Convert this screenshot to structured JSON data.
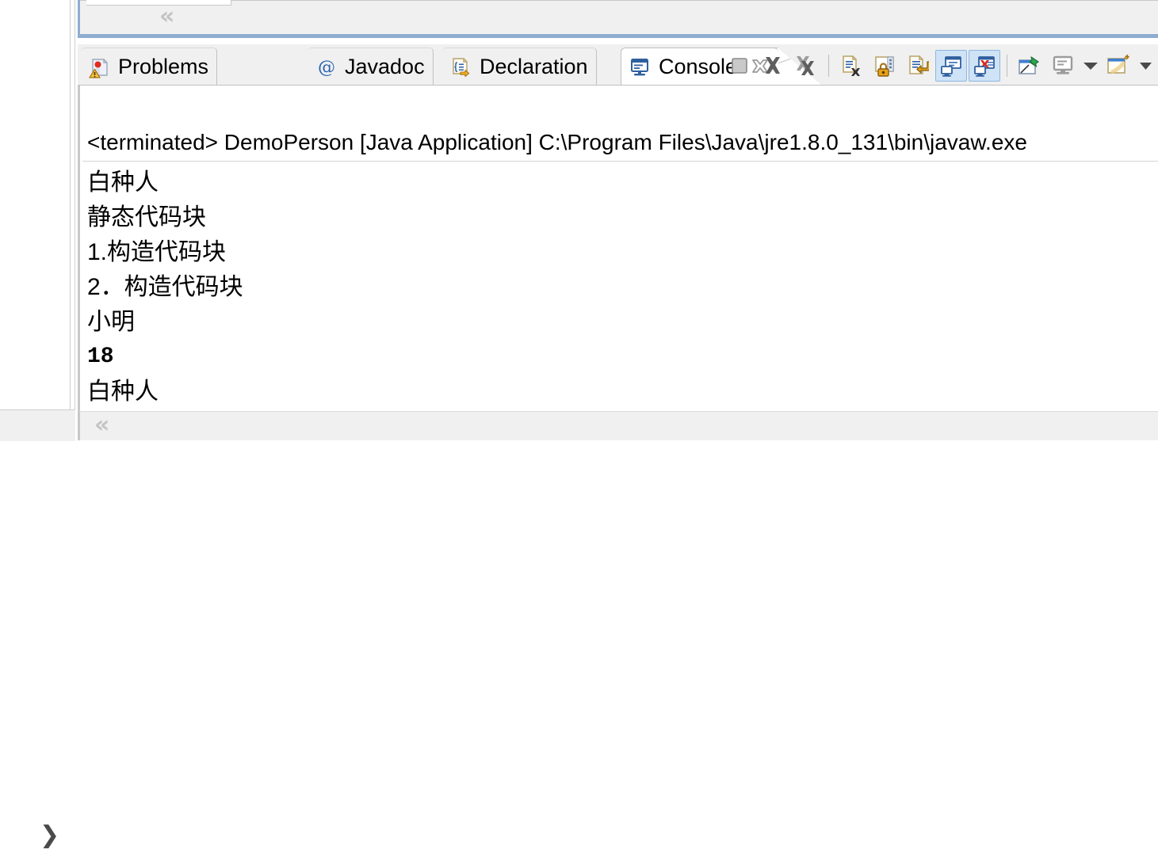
{
  "top_panel": {
    "scroll_chevron": "«"
  },
  "left_status": {
    "expand_arrow": "❯"
  },
  "console_view": {
    "tabs": [
      {
        "id": "problems",
        "label": "Problems",
        "icon": "problems-icon",
        "active": false
      },
      {
        "id": "javadoc",
        "label": "Javadoc",
        "icon": "javadoc-icon",
        "active": false
      },
      {
        "id": "declaration",
        "label": "Declaration",
        "icon": "declaration-icon",
        "active": false
      },
      {
        "id": "console",
        "label": "Console",
        "icon": "console-icon",
        "active": true
      }
    ],
    "close_tab_label": "✖",
    "toolbar": [
      {
        "id": "terminate",
        "name": "terminate-button",
        "tooltip": "Terminate",
        "toggled": false
      },
      {
        "id": "remove-launch",
        "name": "remove-launch-button",
        "tooltip": "Remove Launch",
        "toggled": false
      },
      {
        "id": "remove-all",
        "name": "remove-all-terminated-button",
        "tooltip": "Remove All Terminated Launches",
        "toggled": false
      },
      {
        "id": "clear",
        "name": "clear-console-button",
        "tooltip": "Clear Console",
        "toggled": false
      },
      {
        "id": "scroll-lock",
        "name": "scroll-lock-button",
        "tooltip": "Scroll Lock",
        "toggled": false
      },
      {
        "id": "word-wrap",
        "name": "word-wrap-button",
        "tooltip": "Word Wrap",
        "toggled": false
      },
      {
        "id": "show-stdout",
        "name": "show-console-stdout-button",
        "tooltip": "Show Console When Standard Out Changes",
        "toggled": true
      },
      {
        "id": "show-stderr",
        "name": "show-console-stderr-button",
        "tooltip": "Show Console When Standard Error Changes",
        "toggled": true
      },
      {
        "id": "pin-console",
        "name": "pin-console-button",
        "tooltip": "Pin Console",
        "toggled": false
      },
      {
        "id": "display-console",
        "name": "display-selected-console-button",
        "tooltip": "Display Selected Console",
        "toggled": false
      },
      {
        "id": "new-console",
        "name": "open-console-button",
        "tooltip": "Open Console",
        "toggled": false
      }
    ],
    "status_line": "<terminated> DemoPerson [Java Application] C:\\Program Files\\Java\\jre1.8.0_131\\bin\\javaw.exe",
    "output_lines": [
      {
        "text": "白种人",
        "mono": false
      },
      {
        "text": "静态代码块",
        "mono": false
      },
      {
        "text": "1.构造代码块",
        "mono": false
      },
      {
        "text": "2．构造代码块",
        "mono": false
      },
      {
        "text": "小明",
        "mono": false
      },
      {
        "text": "18",
        "mono": true
      },
      {
        "text": "白种人",
        "mono": false
      }
    ],
    "bottom_chevron": "«"
  },
  "colors": {
    "panel_bg": "#f0f0f0",
    "console_bg": "#ffffff",
    "active_border_blue": "#8fadd0",
    "toggle_bg": "#cfe3f7"
  }
}
